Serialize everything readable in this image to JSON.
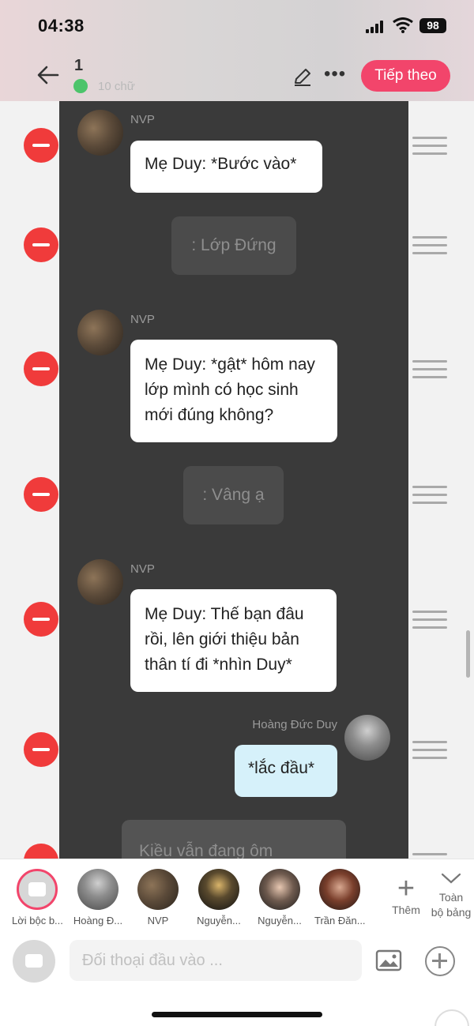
{
  "status": {
    "time": "04:38",
    "battery": "98"
  },
  "header": {
    "title": "1",
    "word_count": "10 chữ",
    "next_label": "Tiếp theo"
  },
  "messages": [
    {
      "speaker": "NVP",
      "text": "Mẹ Duy: *Bước vào*"
    },
    {
      "narration": ": Lớp Đứng"
    },
    {
      "speaker": "NVP",
      "text": "Mẹ Duy: *gật* hôm nay lớp mình có học sinh mới đúng không?"
    },
    {
      "narration": ": Vâng ạ"
    },
    {
      "speaker": "NVP",
      "text": "Mẹ Duy: Thế bạn đâu rồi, lên giới thiệu bản thân tí đi *nhìn Duy*"
    },
    {
      "speaker": "Hoàng Đức Duy",
      "text": "*lắc đầu*"
    },
    {
      "narration": "Kiều vẫn đang ôm"
    }
  ],
  "characters": [
    {
      "name": "Lời bộc b...",
      "icon": "narration-icon"
    },
    {
      "name": "Hoàng Đ..."
    },
    {
      "name": "NVP"
    },
    {
      "name": "Nguyễn..."
    },
    {
      "name": "Nguyễn..."
    },
    {
      "name": "Trần Đăn..."
    }
  ],
  "toolbar": {
    "add_label": "Thêm",
    "collapse_label_1": "Toàn",
    "collapse_label_2": "bộ bảng"
  },
  "input": {
    "placeholder": "Đối thoại đầu vào ..."
  },
  "colors": {
    "accent": "#f2456b",
    "delete": "#f03b3b",
    "panel": "#3a3a3a",
    "me_bubble": "#d6f1fa"
  }
}
